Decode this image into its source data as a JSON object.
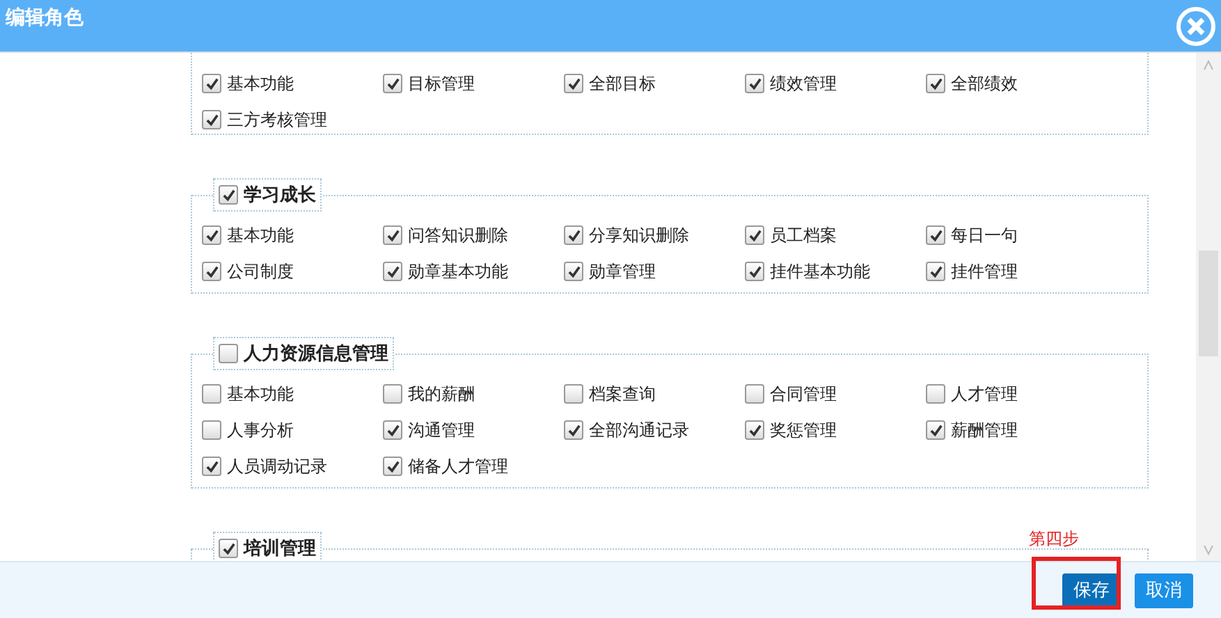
{
  "window": {
    "title": "编辑角色"
  },
  "groups": [
    {
      "items": [
        {
          "label": "基本功能",
          "checked": true
        },
        {
          "label": "目标管理",
          "checked": true
        },
        {
          "label": "全部目标",
          "checked": true
        },
        {
          "label": "绩效管理",
          "checked": true
        },
        {
          "label": "全部绩效",
          "checked": true
        },
        {
          "label": "三方考核管理",
          "checked": true
        }
      ]
    },
    {
      "title": "学习成长",
      "checked": true,
      "items": [
        {
          "label": "基本功能",
          "checked": true
        },
        {
          "label": "问答知识删除",
          "checked": true
        },
        {
          "label": "分享知识删除",
          "checked": true
        },
        {
          "label": "员工档案",
          "checked": true
        },
        {
          "label": "每日一句",
          "checked": true
        },
        {
          "label": "公司制度",
          "checked": true
        },
        {
          "label": "勋章基本功能",
          "checked": true
        },
        {
          "label": "勋章管理",
          "checked": true
        },
        {
          "label": "挂件基本功能",
          "checked": true
        },
        {
          "label": "挂件管理",
          "checked": true
        }
      ]
    },
    {
      "title": "人力资源信息管理",
      "checked": false,
      "items": [
        {
          "label": "基本功能",
          "checked": false
        },
        {
          "label": "我的薪酬",
          "checked": false
        },
        {
          "label": "档案查询",
          "checked": false
        },
        {
          "label": "合同管理",
          "checked": false
        },
        {
          "label": "人才管理",
          "checked": false
        },
        {
          "label": "人事分析",
          "checked": false
        },
        {
          "label": "沟通管理",
          "checked": true
        },
        {
          "label": "全部沟通记录",
          "checked": true
        },
        {
          "label": "奖惩管理",
          "checked": true
        },
        {
          "label": "薪酬管理",
          "checked": true
        },
        {
          "label": "人员调动记录",
          "checked": true
        },
        {
          "label": "储备人才管理",
          "checked": true
        }
      ]
    },
    {
      "title": "培训管理",
      "checked": true
    }
  ],
  "annotation": "第四步",
  "buttons": [
    {
      "label": "保存",
      "kind": "primary"
    },
    {
      "label": "取消",
      "kind": "secondary"
    }
  ]
}
